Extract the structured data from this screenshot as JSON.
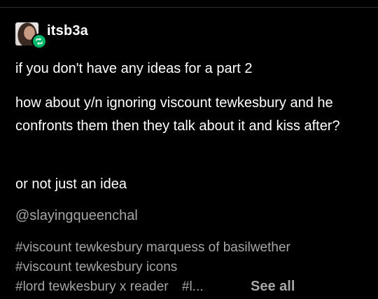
{
  "post": {
    "username": "itsb3a",
    "paragraphs": [
      "if you don't have any ideas for a part 2",
      "how about y/n ignoring viscount tewkesbury and he confronts them then they talk about it and kiss after?",
      "or not just an idea"
    ],
    "mention": "@slayingqueenchal",
    "tags": [
      "#viscount tewkesbury marquess of basilwether",
      "#viscount tewkesbury icons",
      "#lord tewkesbury x reader",
      "#l..."
    ],
    "see_all": "See all"
  },
  "icons": {
    "reblog_badge": "reblog-icon",
    "avatar": "avatar"
  },
  "colors": {
    "background": "#000000",
    "text": "#ffffff",
    "muted": "#a6a6a6",
    "reblog_green": "#00b86b"
  }
}
